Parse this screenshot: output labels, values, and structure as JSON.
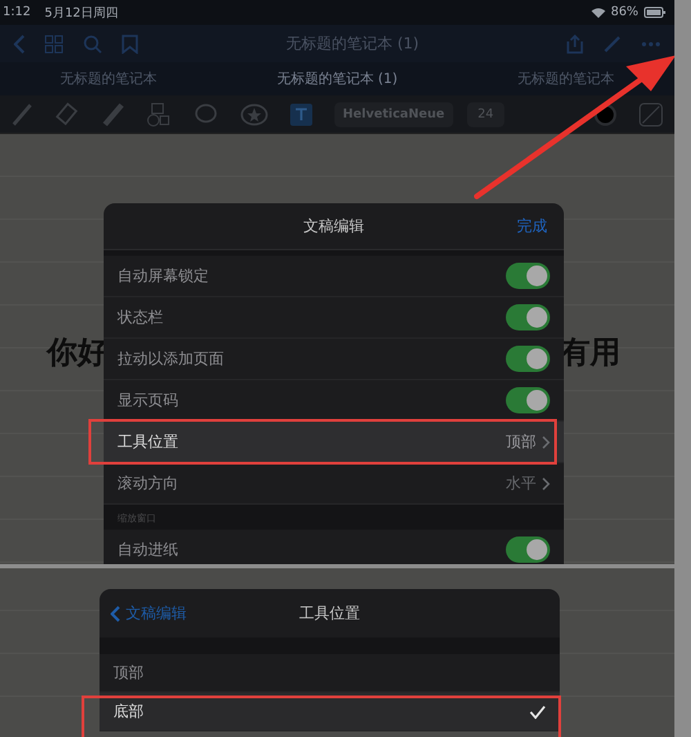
{
  "status_bar": {
    "time": "1:12",
    "date": "5月12日周四",
    "battery": "86%"
  },
  "nav": {
    "title": "无标题的笔记本 (1)"
  },
  "tabs": [
    {
      "label": "无标题的笔记本",
      "selected": false
    },
    {
      "label": "无标题的笔记本 (1)",
      "selected": true
    },
    {
      "label": "无标题的笔记本",
      "selected": false
    }
  ],
  "toolbar": {
    "font": "HelveticaNeue",
    "size": "24"
  },
  "note_text": [
    "你好",
    "有用"
  ],
  "settings_dialog": {
    "title": "文稿编辑",
    "done": "完成",
    "rows": [
      {
        "kind": "toggle",
        "label": "自动屏幕锁定",
        "on": true
      },
      {
        "kind": "toggle",
        "label": "状态栏",
        "on": true
      },
      {
        "kind": "toggle",
        "label": "拉动以添加页面",
        "on": true
      },
      {
        "kind": "toggle",
        "label": "显示页码",
        "on": true
      },
      {
        "kind": "value",
        "label": "工具位置",
        "value": "顶部",
        "highlighted": true
      },
      {
        "kind": "value",
        "label": "滚动方向",
        "value": "水平",
        "highlighted": false
      },
      {
        "kind": "header",
        "label": "缩放窗口"
      },
      {
        "kind": "toggle",
        "label": "自动进纸",
        "on": true
      }
    ]
  },
  "position_dialog": {
    "back": "文稿编辑",
    "title": "工具位置",
    "options": [
      {
        "label": "顶部",
        "selected": false
      },
      {
        "label": "底部",
        "selected": true
      }
    ]
  }
}
